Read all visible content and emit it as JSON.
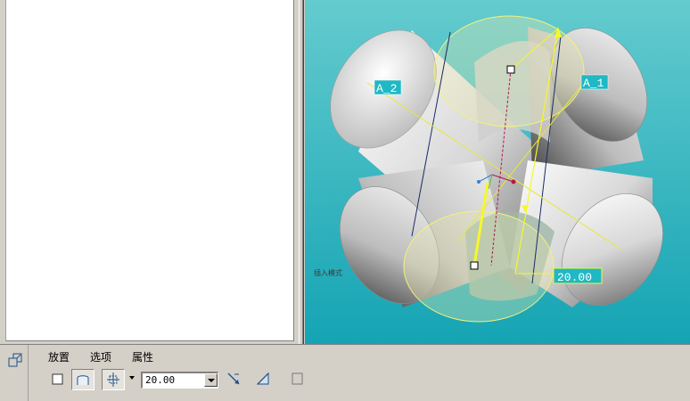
{
  "viewport": {
    "datum_axis_a2": "A_2",
    "datum_axis_a1": "A_1",
    "dimension_value": "20.00",
    "mode_hint": "插入模式"
  },
  "dashboard": {
    "tabs": [
      "放置",
      "选项",
      "属性"
    ],
    "depth_value": "20.00"
  },
  "colors": {
    "viewport_top": "#64cbce",
    "viewport_bottom": "#15a4b4",
    "datum_tag_bg": "#1fb8c4",
    "datum_tag_text": "#ffffff",
    "sketch_yellow": "#f7f729"
  }
}
